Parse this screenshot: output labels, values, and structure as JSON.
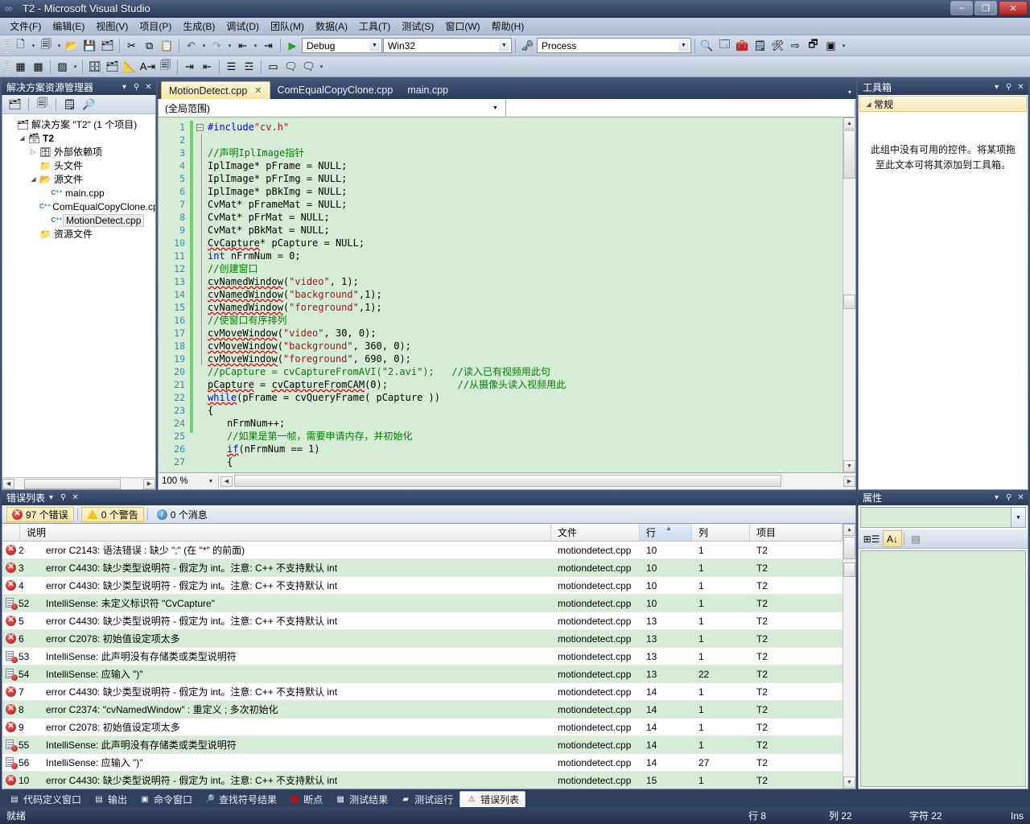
{
  "window": {
    "title": "T2 - Microsoft Visual Studio",
    "logo_icon": "visual-studio-logo-icon",
    "controls": {
      "minimize": "–",
      "restore": "❐",
      "close": "✕"
    }
  },
  "menubar": {
    "items": [
      {
        "label": "文件(F)"
      },
      {
        "label": "编辑(E)"
      },
      {
        "label": "视图(V)"
      },
      {
        "label": "项目(P)"
      },
      {
        "label": "生成(B)"
      },
      {
        "label": "调试(D)"
      },
      {
        "label": "团队(M)"
      },
      {
        "label": "数据(A)"
      },
      {
        "label": "工具(T)"
      },
      {
        "label": "测试(S)"
      },
      {
        "label": "窗口(W)"
      },
      {
        "label": "帮助(H)"
      }
    ]
  },
  "toolbar": {
    "configuration": "Debug",
    "platform": "Win32",
    "process": "Process",
    "icons_row1": [
      "new-project-icon",
      "add-item-icon",
      "open-file-icon",
      "save-icon",
      "save-all-icon",
      "cut-icon",
      "copy-icon",
      "paste-icon",
      "undo-icon",
      "redo-icon",
      "navigate-backward-icon",
      "navigate-forward-icon",
      "start-debug-icon"
    ],
    "icons_row2": [
      "new-breakpoint-icon",
      "breakpoints-window-icon",
      "disable-breakpoints-icon",
      "solution-explorer-icon",
      "properties-window-icon",
      "object-browser-icon",
      "toolbox-icon",
      "document-outline-icon",
      "indent-icon",
      "outdent-icon",
      "comment-icon",
      "uncomment-icon",
      "toggle-bookmark-icon",
      "previous-bookmark-icon",
      "window-icon",
      "comment-block-icon",
      "uncomment-block-icon"
    ],
    "icons_row1_right": [
      "find-symbol-icon",
      "properties-page-icon",
      "toolbox-panel-icon",
      "object-browser2-icon",
      "tools-options-icon",
      "step-into-icon",
      "windows-forms-icon",
      "command-window-icon"
    ]
  },
  "solution_explorer": {
    "title": "解决方案资源管理器",
    "header_buttons": {
      "dropdown": "▾",
      "pin": "⚲",
      "close": "✕"
    },
    "toolbar_icons": [
      "properties-window-icon",
      "show-all-files-icon",
      "view-code-icon",
      "refresh-icon"
    ],
    "tree": [
      {
        "label": "解决方案 \"T2\" (1 个项目)",
        "icon": "solution-icon",
        "indent": 0,
        "twisty": "",
        "bold": false
      },
      {
        "label": "T2",
        "icon": "project-icon",
        "indent": 1,
        "twisty": "◢",
        "bold": true
      },
      {
        "label": "外部依赖项",
        "icon": "dependencies-icon",
        "indent": 2,
        "twisty": "▷",
        "bold": false
      },
      {
        "label": "头文件",
        "icon": "folder-icon",
        "indent": 2,
        "twisty": "",
        "bold": false
      },
      {
        "label": "源文件",
        "icon": "folder-open-icon",
        "indent": 2,
        "twisty": "◢",
        "bold": false
      },
      {
        "label": "main.cpp",
        "icon": "cpp-file-icon",
        "indent": 3,
        "twisty": "",
        "bold": false
      },
      {
        "label": "ComEqualCopyClone.cpp",
        "icon": "cpp-file-icon",
        "indent": 3,
        "twisty": "",
        "bold": false
      },
      {
        "label": "MotionDetect.cpp",
        "icon": "cpp-file-icon",
        "indent": 3,
        "twisty": "",
        "bold": false,
        "selected": true
      },
      {
        "label": "资源文件",
        "icon": "folder-icon",
        "indent": 2,
        "twisty": "",
        "bold": false
      }
    ]
  },
  "editor": {
    "tabs": [
      {
        "label": "MotionDetect.cpp",
        "active": true,
        "close": "✕"
      },
      {
        "label": "ComEqualCopyClone.cpp",
        "active": false
      },
      {
        "label": "main.cpp",
        "active": false
      }
    ],
    "nav_scope": "(全局范围)",
    "nav_member": "",
    "zoom": "100 %",
    "lines": [
      {
        "n": 1,
        "indent": 0,
        "parts": [
          {
            "t": "#include",
            "c": "pre"
          },
          {
            "t": "\"cv.h\"",
            "c": "str"
          }
        ]
      },
      {
        "n": 2,
        "indent": 0,
        "parts": []
      },
      {
        "n": 3,
        "indent": 0,
        "parts": [
          {
            "t": "//声明IplImage指针",
            "c": "cmt"
          }
        ]
      },
      {
        "n": 4,
        "indent": 0,
        "parts": [
          {
            "t": "IplImage* pFrame = NULL;",
            "c": ""
          }
        ]
      },
      {
        "n": 5,
        "indent": 0,
        "parts": [
          {
            "t": "IplImage* pFrImg = NULL;",
            "c": ""
          }
        ]
      },
      {
        "n": 6,
        "indent": 0,
        "parts": [
          {
            "t": "IplImage* pBkImg = NULL;",
            "c": ""
          }
        ]
      },
      {
        "n": 7,
        "indent": 0,
        "parts": [
          {
            "t": "CvMat* pFrameMat = NULL;",
            "c": ""
          }
        ]
      },
      {
        "n": 8,
        "indent": 0,
        "parts": [
          {
            "t": "CvMat* pFrMat = NULL;",
            "c": ""
          }
        ]
      },
      {
        "n": 9,
        "indent": 0,
        "parts": [
          {
            "t": "CvMat* pBkMat = NULL;",
            "c": ""
          }
        ]
      },
      {
        "n": 10,
        "indent": 0,
        "parts": [
          {
            "t": "CvCapture",
            "c": "sq"
          },
          {
            "t": "* pCapture = NULL;",
            "c": ""
          }
        ]
      },
      {
        "n": 11,
        "indent": 0,
        "parts": [
          {
            "t": "int",
            "c": "kw"
          },
          {
            "t": " nFrmNum = 0;",
            "c": ""
          }
        ]
      },
      {
        "n": 12,
        "indent": 0,
        "parts": [
          {
            "t": "//创建窗口",
            "c": "cmt"
          }
        ]
      },
      {
        "n": 13,
        "indent": 0,
        "parts": [
          {
            "t": "cvNamedWindow",
            "c": "sq"
          },
          {
            "t": "(",
            "c": ""
          },
          {
            "t": "\"video\"",
            "c": "str"
          },
          {
            "t": ", 1);",
            "c": ""
          }
        ]
      },
      {
        "n": 14,
        "indent": 0,
        "parts": [
          {
            "t": "cvNamedWindow",
            "c": "sq"
          },
          {
            "t": "(",
            "c": ""
          },
          {
            "t": "\"background\"",
            "c": "str"
          },
          {
            "t": ",1);",
            "c": ""
          }
        ]
      },
      {
        "n": 15,
        "indent": 0,
        "parts": [
          {
            "t": "cvNamedWindow",
            "c": "sq"
          },
          {
            "t": "(",
            "c": ""
          },
          {
            "t": "\"foreground\"",
            "c": "str"
          },
          {
            "t": ",1);",
            "c": ""
          }
        ]
      },
      {
        "n": 16,
        "indent": 0,
        "parts": [
          {
            "t": "//使窗口有序排列",
            "c": "cmt"
          }
        ]
      },
      {
        "n": 17,
        "indent": 0,
        "parts": [
          {
            "t": "cvMoveWindow",
            "c": "sq"
          },
          {
            "t": "(",
            "c": ""
          },
          {
            "t": "\"video\"",
            "c": "str"
          },
          {
            "t": ", 30, 0);",
            "c": ""
          }
        ]
      },
      {
        "n": 18,
        "indent": 0,
        "parts": [
          {
            "t": "cvMoveWindow",
            "c": "sq"
          },
          {
            "t": "(",
            "c": ""
          },
          {
            "t": "\"background\"",
            "c": "str"
          },
          {
            "t": ", 360, 0);",
            "c": ""
          }
        ]
      },
      {
        "n": 19,
        "indent": 0,
        "parts": [
          {
            "t": "cvMoveWindow",
            "c": "sq"
          },
          {
            "t": "(",
            "c": ""
          },
          {
            "t": "\"foreground\"",
            "c": "str"
          },
          {
            "t": ", 690, 0);",
            "c": ""
          }
        ]
      },
      {
        "n": 20,
        "indent": 0,
        "parts": [
          {
            "t": "//pCapture = cvCaptureFromAVI(\"2.avi\");   //读入已有视频用此句",
            "c": "cmt"
          }
        ]
      },
      {
        "n": 21,
        "indent": 0,
        "parts": [
          {
            "t": "pCapture",
            "c": "sq"
          },
          {
            "t": " = ",
            "c": ""
          },
          {
            "t": "cvCaptureFromCAM",
            "c": "sq"
          },
          {
            "t": "(0);",
            "c": ""
          },
          {
            "t": "            //从摄像头读入视频用此",
            "c": "cmt"
          }
        ]
      },
      {
        "n": 22,
        "indent": 0,
        "parts": [
          {
            "t": "while",
            "c": "kw sq"
          },
          {
            "t": "(pFrame = cvQueryFrame( pCapture ))",
            "c": ""
          }
        ]
      },
      {
        "n": 23,
        "indent": 0,
        "parts": [
          {
            "t": "{",
            "c": ""
          }
        ]
      },
      {
        "n": 24,
        "indent": 1,
        "parts": [
          {
            "t": "nFrmNum++;",
            "c": ""
          }
        ]
      },
      {
        "n": 25,
        "indent": 1,
        "parts": [
          {
            "t": "//如果是第一帧，需要申请内存，并初始化",
            "c": "cmt"
          }
        ]
      },
      {
        "n": 26,
        "indent": 1,
        "parts": [
          {
            "t": "if",
            "c": "kw sq"
          },
          {
            "t": "(nFrmNum == 1)",
            "c": ""
          }
        ]
      },
      {
        "n": 27,
        "indent": 1,
        "parts": [
          {
            "t": "{",
            "c": ""
          }
        ]
      }
    ]
  },
  "toolbox": {
    "title": "工具箱",
    "header_buttons": {
      "dropdown": "▾",
      "pin": "⚲",
      "close": "✕"
    },
    "group": "常规",
    "group_twisty": "◢",
    "message": "此组中没有可用的控件。将某项拖至此文本可将其添加到工具箱。"
  },
  "properties": {
    "title": "属性",
    "header_buttons": {
      "dropdown": "▾",
      "pin": "⚲",
      "close": "✕"
    },
    "selected_object": "",
    "toolbar_icons": [
      "categorized-icon",
      "alphabetical-icon",
      "property-pages-icon"
    ]
  },
  "error_list": {
    "title": "错误列表",
    "header_buttons": {
      "dropdown": "▾",
      "pin": "⚲",
      "close": "✕"
    },
    "errors_chip": "97 个错误",
    "warnings_chip": "0 个警告",
    "messages_chip": "0 个消息",
    "columns": [
      {
        "key": "icon",
        "label": ""
      },
      {
        "key": "desc",
        "label": "说明"
      },
      {
        "key": "file",
        "label": "文件"
      },
      {
        "key": "line",
        "label": "行",
        "sorted": true,
        "sort_dir": "▲"
      },
      {
        "key": "col",
        "label": "列"
      },
      {
        "key": "proj",
        "label": "项目"
      }
    ],
    "rows": [
      {
        "icon": "error-icon",
        "num": "2",
        "desc": "error C2143: 语法错误 : 缺少 \";\" (在 \"*\" 的前面)",
        "file": "motiondetect.cpp",
        "line": "10",
        "col": "1",
        "proj": "T2"
      },
      {
        "icon": "error-icon",
        "num": "3",
        "desc": "error C4430: 缺少类型说明符 - 假定为 int。注意: C++ 不支持默认 int",
        "file": "motiondetect.cpp",
        "line": "10",
        "col": "1",
        "proj": "T2"
      },
      {
        "icon": "error-icon",
        "num": "4",
        "desc": "error C4430: 缺少类型说明符 - 假定为 int。注意: C++ 不支持默认 int",
        "file": "motiondetect.cpp",
        "line": "10",
        "col": "1",
        "proj": "T2"
      },
      {
        "icon": "intellisense-error-icon",
        "num": "52",
        "desc": "IntelliSense: 未定义标识符 \"CvCapture\"",
        "file": "motiondetect.cpp",
        "line": "10",
        "col": "1",
        "proj": "T2"
      },
      {
        "icon": "error-icon",
        "num": "5",
        "desc": "error C4430: 缺少类型说明符 - 假定为 int。注意: C++ 不支持默认 int",
        "file": "motiondetect.cpp",
        "line": "13",
        "col": "1",
        "proj": "T2"
      },
      {
        "icon": "error-icon",
        "num": "6",
        "desc": "error C2078: 初始值设定项太多",
        "file": "motiondetect.cpp",
        "line": "13",
        "col": "1",
        "proj": "T2"
      },
      {
        "icon": "intellisense-error-icon",
        "num": "53",
        "desc": "IntelliSense: 此声明没有存储类或类型说明符",
        "file": "motiondetect.cpp",
        "line": "13",
        "col": "1",
        "proj": "T2"
      },
      {
        "icon": "intellisense-error-icon",
        "num": "54",
        "desc": "IntelliSense: 应输入 \")\"",
        "file": "motiondetect.cpp",
        "line": "13",
        "col": "22",
        "proj": "T2"
      },
      {
        "icon": "error-icon",
        "num": "7",
        "desc": "error C4430: 缺少类型说明符 - 假定为 int。注意: C++ 不支持默认 int",
        "file": "motiondetect.cpp",
        "line": "14",
        "col": "1",
        "proj": "T2"
      },
      {
        "icon": "error-icon",
        "num": "8",
        "desc": "error C2374: \"cvNamedWindow\" : 重定义 ; 多次初始化",
        "file": "motiondetect.cpp",
        "line": "14",
        "col": "1",
        "proj": "T2"
      },
      {
        "icon": "error-icon",
        "num": "9",
        "desc": "error C2078: 初始值设定项太多",
        "file": "motiondetect.cpp",
        "line": "14",
        "col": "1",
        "proj": "T2"
      },
      {
        "icon": "intellisense-error-icon",
        "num": "55",
        "desc": "IntelliSense: 此声明没有存储类或类型说明符",
        "file": "motiondetect.cpp",
        "line": "14",
        "col": "1",
        "proj": "T2"
      },
      {
        "icon": "intellisense-error-icon",
        "num": "56",
        "desc": "IntelliSense: 应输入 \")\"",
        "file": "motiondetect.cpp",
        "line": "14",
        "col": "27",
        "proj": "T2"
      },
      {
        "icon": "error-icon",
        "num": "10",
        "desc": "error C4430: 缺少类型说明符 - 假定为 int。注意: C++ 不支持默认 int",
        "file": "motiondetect.cpp",
        "line": "15",
        "col": "1",
        "proj": "T2"
      }
    ]
  },
  "bottom_tabs": [
    {
      "label": "代码定义窗口",
      "icon": "code-definition-icon",
      "active": false
    },
    {
      "label": "输出",
      "icon": "output-icon",
      "active": false
    },
    {
      "label": "命令窗口",
      "icon": "command-window-icon",
      "active": false
    },
    {
      "label": "查找符号结果",
      "icon": "find-symbol-results-icon",
      "active": false
    },
    {
      "label": "断点",
      "icon": "breakpoints-icon",
      "active": false
    },
    {
      "label": "测试结果",
      "icon": "test-results-icon",
      "active": false
    },
    {
      "label": "测试运行",
      "icon": "test-runs-icon",
      "active": false
    },
    {
      "label": "错误列表",
      "icon": "error-list-icon",
      "active": true
    }
  ],
  "statusbar": {
    "status": "就绪",
    "line": "行 8",
    "column": "列 22",
    "character": "字符 22",
    "insert_mode": "Ins"
  }
}
